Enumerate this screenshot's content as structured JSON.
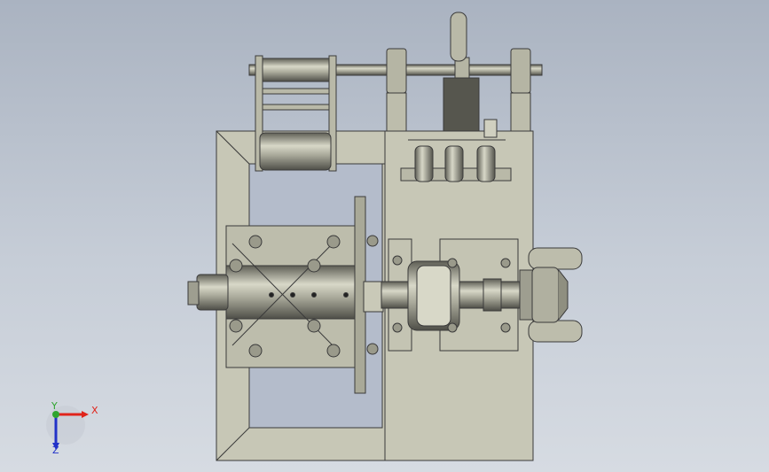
{
  "viewport": {
    "background_top": "#aab3c1",
    "background_bottom": "#d6dbe2",
    "part_fill": "#c5c5b3",
    "part_stroke": "#3a3a3a",
    "shade_fill": "#8f8f80",
    "cylinder_dark": "#6e6e63"
  },
  "triad": {
    "x_label": "X",
    "y_label": "Y",
    "z_label": "Z",
    "x_color": "#e0241b",
    "y_color": "#2fa52f",
    "z_color": "#2232c8"
  },
  "icons": [
    "coordinate-triad-icon"
  ]
}
